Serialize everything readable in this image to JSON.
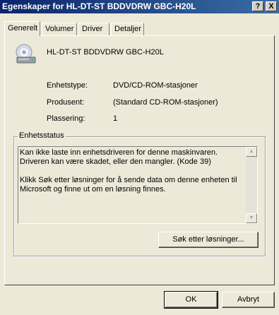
{
  "window": {
    "title": "Egenskaper for HL-DT-ST BDDVDRW GBC-H20L",
    "help_label": "?",
    "close_label": "X"
  },
  "tabs": [
    {
      "label": "Generelt",
      "active": true
    },
    {
      "label": "Volumer",
      "active": false
    },
    {
      "label": "Driver",
      "active": false
    },
    {
      "label": "Detaljer",
      "active": false
    }
  ],
  "device": {
    "icon": "cd-drive-icon",
    "name": "HL-DT-ST BDDVDRW GBC-H20L"
  },
  "properties": [
    {
      "label": "Enhetstype:",
      "value": "DVD/CD-ROM-stasjoner"
    },
    {
      "label": "Produsent:",
      "value": "(Standard CD-ROM-stasjoner)"
    },
    {
      "label": "Plassering:",
      "value": "1"
    }
  ],
  "status": {
    "legend": "Enhetsstatus",
    "paragraph1": "Kan ikke laste inn enhetsdriveren for denne maskinvaren. Driveren kan være skadet, eller den mangler. (Kode 39)",
    "paragraph2": "Klikk Søk etter løsninger for å sende data om denne enheten til Microsoft og finne ut om en løsning finnes.",
    "search_button": "Søk etter løsninger..."
  },
  "footer": {
    "ok_label": "OK",
    "cancel_label": "Avbryt"
  }
}
